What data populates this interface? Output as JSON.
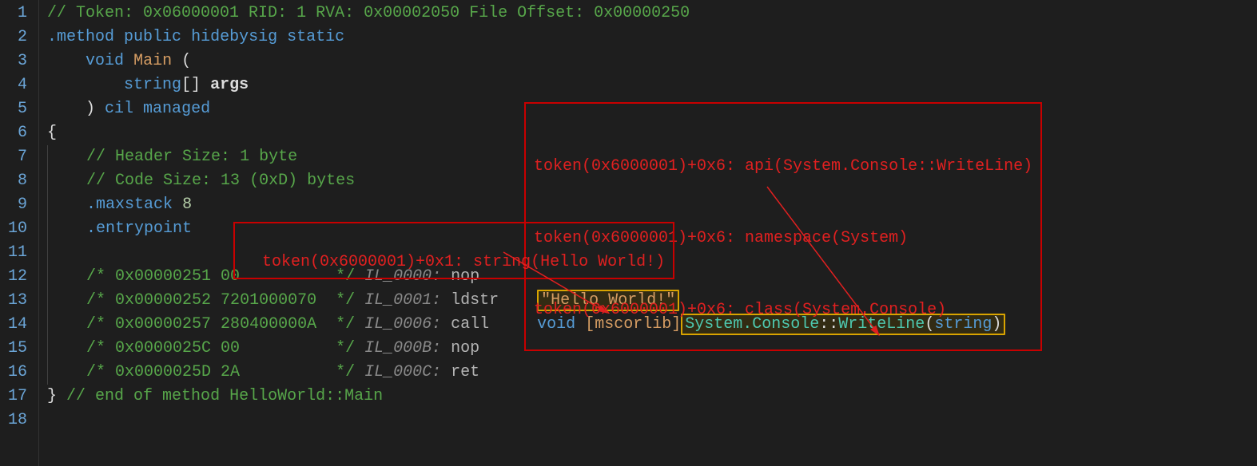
{
  "gutter": [
    "1",
    "2",
    "3",
    "4",
    "5",
    "6",
    "7",
    "8",
    "9",
    "10",
    "11",
    "12",
    "13",
    "14",
    "15",
    "16",
    "17",
    "18"
  ],
  "lines": {
    "l1_comment": "// Token: 0x06000001 RID: 1 RVA: 0x00002050 File Offset: 0x00000250",
    "l2_kw1": ".method",
    "l2_kw2": "public",
    "l2_kw3": "hidebysig",
    "l2_kw4": "static",
    "l3_void": "void",
    "l3_main": "Main",
    "l3_paren": " (",
    "l4_type": "string",
    "l4_br": "[]",
    "l4_args": "args",
    "l5_paren": ") ",
    "l5_cil": "cil managed",
    "l6_brace": "{",
    "l7_comment": "// Header Size: 1 byte",
    "l8_comment": "// Code Size: 13 (0xD) bytes",
    "l9_kw": ".maxstack",
    "l9_num": "8",
    "l10_kw": ".entrypoint",
    "l12_c": "/* 0x00000251 00          */",
    "l12_il": "IL_0000:",
    "l12_op": "nop",
    "l13_c": "/* 0x00000252 7201000070  */",
    "l13_il": "IL_0001:",
    "l13_op": "ldstr",
    "l13_str": "\"Hello World!\"",
    "l14_c": "/* 0x00000257 280400000A  */",
    "l14_il": "IL_0006:",
    "l14_op": "call",
    "l14_void": "void",
    "l14_lib": "[mscorlib]",
    "l14_ns": "System.",
    "l14_cls": "Console",
    "l14_sep": "::",
    "l14_m": "WriteLine",
    "l14_p1": "(",
    "l14_pt": "string",
    "l14_p2": ")",
    "l15_c": "/* 0x0000025C 00          */",
    "l15_il": "IL_000B:",
    "l15_op": "nop",
    "l16_c": "/* 0x0000025D 2A          */",
    "l16_il": "IL_000C:",
    "l16_op": "ret",
    "l17_brace": "}",
    "l17_comment": " // end of method HelloWorld::Main"
  },
  "annotations": {
    "box1": {
      "line1": "token(0x6000001)+0x6: api(System.Console::WriteLine)",
      "line2": "token(0x6000001)+0x6: namespace(System)",
      "line3": "token(0x6000001)+0x6: class(System.Console)"
    },
    "box2": "token(0x6000001)+0x1: string(Hello World!)"
  }
}
